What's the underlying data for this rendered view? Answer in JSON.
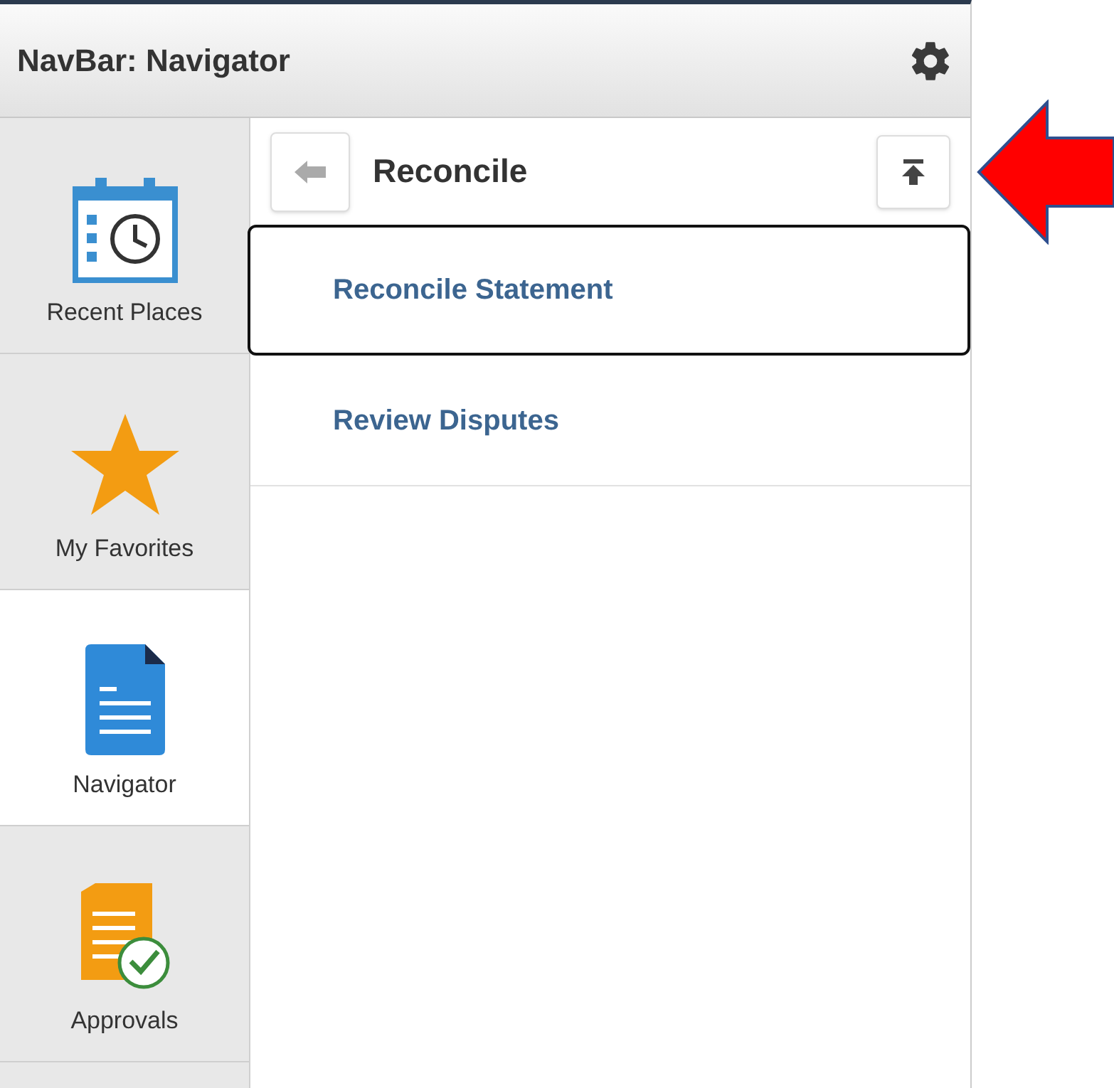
{
  "header": {
    "title": "NavBar: Navigator"
  },
  "sidebar": {
    "items": [
      {
        "label": "Recent Places",
        "kind": "calendar",
        "selected": false
      },
      {
        "label": "My Favorites",
        "kind": "star",
        "selected": false
      },
      {
        "label": "Navigator",
        "kind": "document",
        "selected": true
      },
      {
        "label": "Approvals",
        "kind": "approvals",
        "selected": false
      }
    ]
  },
  "content": {
    "title": "Reconcile",
    "items": [
      {
        "label": "Reconcile Statement",
        "selected": true
      },
      {
        "label": "Review Disputes",
        "selected": false
      }
    ]
  },
  "annotation": {
    "kind": "arrow"
  }
}
